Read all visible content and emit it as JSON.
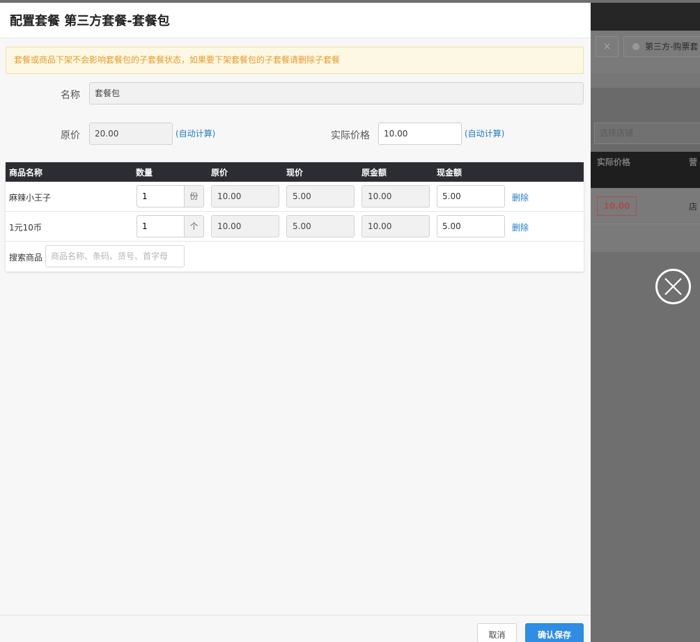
{
  "dialog": {
    "title": "配置套餐 第三方套餐-套餐包",
    "notice": "套餐或商品下架不会影响套餐包的子套餐状态，如果要下架套餐包的子套餐请删除子套餐"
  },
  "form": {
    "name_label": "名称",
    "name_value": "套餐包",
    "orig_price_label": "原价",
    "orig_price_value": "20.00",
    "orig_price_auto": "(自动计算)",
    "actual_price_label": "实际价格",
    "actual_price_value": "10.00",
    "actual_price_auto": "(自动计算)"
  },
  "table": {
    "headers": [
      "商品名称",
      "数量",
      "原价",
      "现价",
      "原金额",
      "现金额"
    ],
    "rows": [
      {
        "name": "麻辣小王子",
        "qty": "1",
        "unit": "份",
        "orig_price": "10.00",
        "cur_price": "5.00",
        "orig_amount": "10.00",
        "cur_amount": "5.00",
        "action": "删除"
      },
      {
        "name": "1元10币",
        "qty": "1",
        "unit": "个",
        "orig_price": "10.00",
        "cur_price": "5.00",
        "orig_amount": "10.00",
        "cur_amount": "5.00",
        "action": "删除"
      }
    ],
    "search_label": "搜索商品",
    "search_placeholder": "商品名称、条码、货号、首字母"
  },
  "footer": {
    "cancel_label": "取消",
    "save_label": "确认保存"
  },
  "background": {
    "tab_close": "×",
    "tab_label": "第三方-购票套",
    "store_select_placeholder": "选择店铺",
    "col_actual_price": "实际价格",
    "col_cut": "营",
    "price_badge": "10.00",
    "store_text": "店"
  },
  "colors": {
    "accent": "#2f8de4",
    "link": "#1e7dc9",
    "notice_text": "#e99a2c",
    "notice_bg": "#fcf8e3",
    "table_header_bg": "#2b2d33"
  }
}
